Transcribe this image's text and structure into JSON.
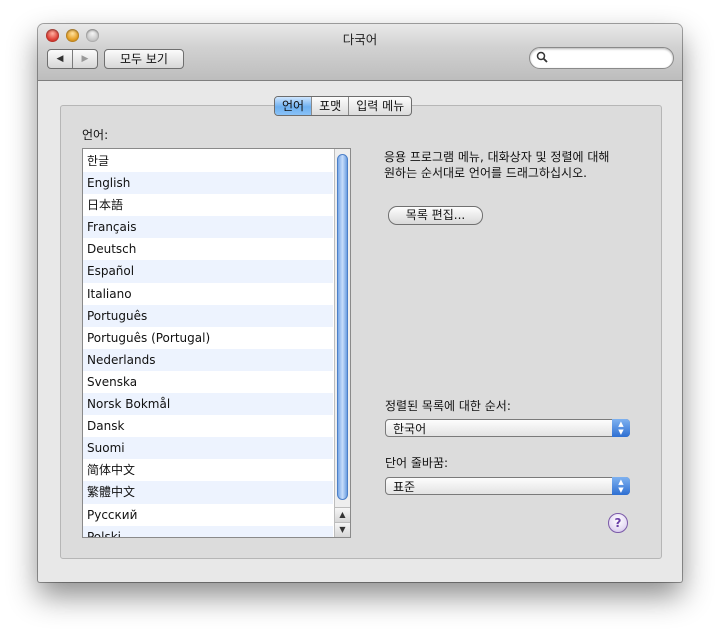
{
  "window": {
    "title": "다국어"
  },
  "toolbar": {
    "back_icon": "◀",
    "forward_icon": "▶",
    "show_all_label": "모두 보기",
    "search_value": ""
  },
  "tabs": [
    {
      "label": "언어"
    },
    {
      "label": "포맷"
    },
    {
      "label": "입력 메뉴"
    }
  ],
  "languages": {
    "label": "언어:",
    "items": [
      "한글",
      "English",
      "日本語",
      "Français",
      "Deutsch",
      "Español",
      "Italiano",
      "Português",
      "Português (Portugal)",
      "Nederlands",
      "Svenska",
      "Norsk Bokmål",
      "Dansk",
      "Suomi",
      "简体中文",
      "繁體中文",
      "Русский",
      "Polski"
    ]
  },
  "description": "응용 프로그램 메뉴, 대화상자 및 정렬에 대해 원하는 순서대로 언어를 드래그하십시오.",
  "edit_button_label": "목록 편집...",
  "sort": {
    "label": "정렬된 목록에 대한 순서:",
    "value": "한국어"
  },
  "word_break": {
    "label": "단어 줄바꿈:",
    "value": "표준"
  },
  "help_label": "?",
  "colors": {
    "accent": "#6eb0f0",
    "row_alt": "#edf3fe"
  }
}
